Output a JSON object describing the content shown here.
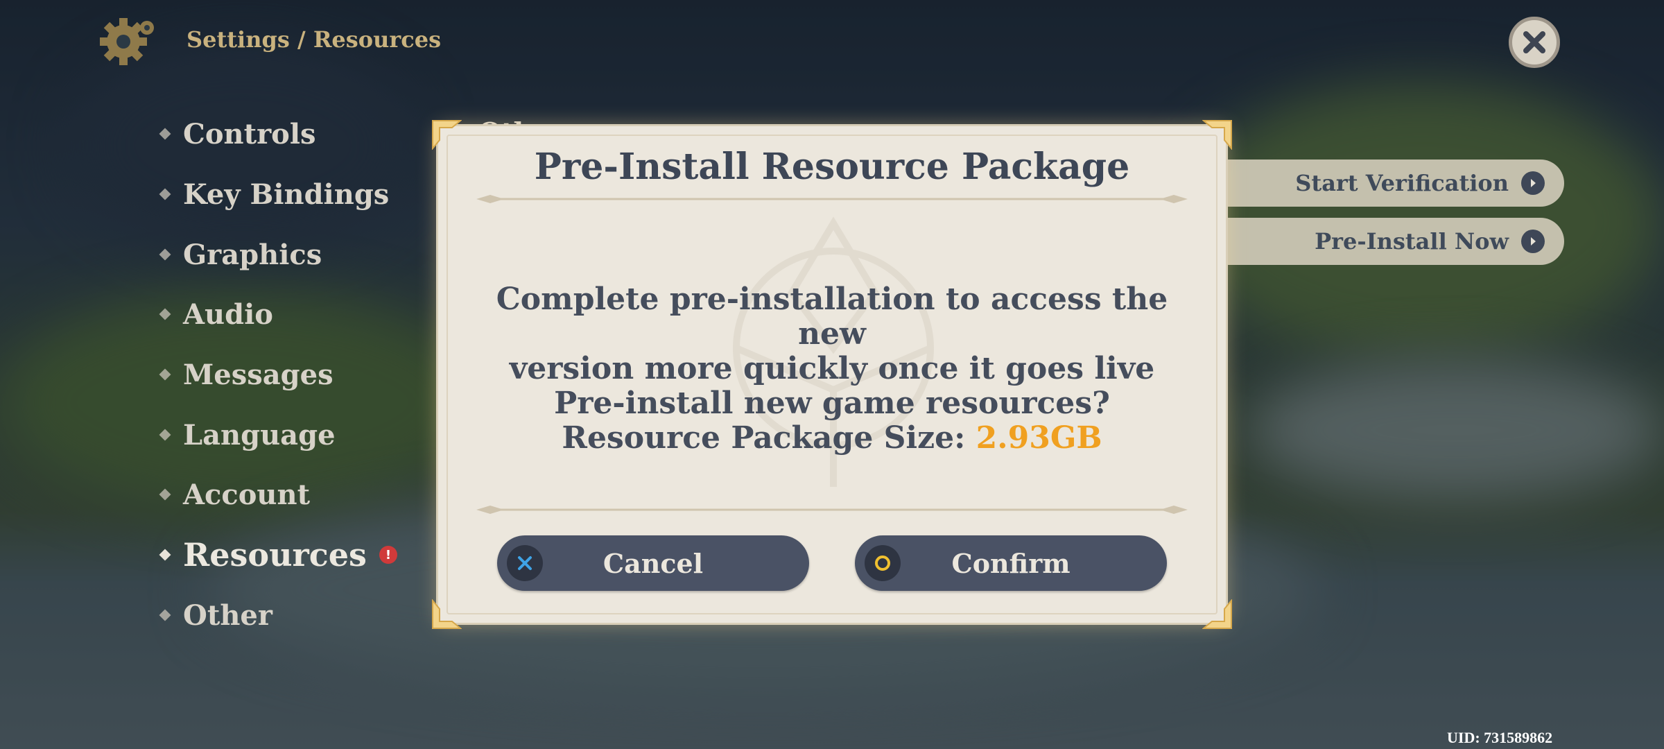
{
  "header": {
    "breadcrumb": "Settings / Resources"
  },
  "menu": {
    "items": [
      {
        "label": "Controls"
      },
      {
        "label": "Key Bindings"
      },
      {
        "label": "Graphics"
      },
      {
        "label": "Audio"
      },
      {
        "label": "Messages"
      },
      {
        "label": "Language"
      },
      {
        "label": "Account"
      },
      {
        "label": "Resources"
      },
      {
        "label": "Other"
      }
    ],
    "active": "Resources",
    "alert_badge": "!",
    "partial_heading": "Oth"
  },
  "actions": {
    "start_verification": "Start Verification",
    "pre_install_now": "Pre-Install Now"
  },
  "dialog": {
    "title": "Pre-Install Resource Package",
    "line1": "Complete pre-installation to access the new",
    "line2": "version more quickly once it goes live",
    "line3": "Pre-install new game resources?",
    "size_label": "Resource Package Size: ",
    "size_value": "2.93GB",
    "cancel": "Cancel",
    "confirm": "Confirm"
  },
  "footer": {
    "uid": "UID: 731589862"
  },
  "colors": {
    "accent_orange": "#f0a020",
    "button_bg": "#4a5265",
    "dialog_bg": "#ece7dd",
    "breadcrumb_gold": "#c9b27e"
  },
  "icons": [
    "gear-icon",
    "close-icon",
    "arrow-right-icon",
    "cross-icon",
    "circle-icon",
    "diamond-bullet-icon",
    "corner-ornament-icon"
  ]
}
